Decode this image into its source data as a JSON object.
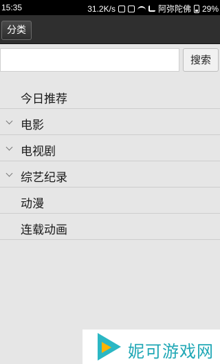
{
  "statusbar": {
    "time": "15:35",
    "net_speed": "31.2K/s",
    "carrier": "阿弥陀佛",
    "battery": "29%",
    "icons": [
      "headset-icon",
      "alarm-icon",
      "wifi-icon",
      "signal-icon",
      "battery-icon"
    ]
  },
  "header": {
    "category_button": "分类"
  },
  "search": {
    "input_value": "",
    "button_label": "搜索"
  },
  "list": {
    "items": [
      {
        "label": "今日推荐",
        "expandable": false
      },
      {
        "label": "电影",
        "expandable": true
      },
      {
        "label": "电视剧",
        "expandable": true
      },
      {
        "label": "综艺纪录",
        "expandable": true
      },
      {
        "label": "动漫",
        "expandable": false
      },
      {
        "label": "连载动画",
        "expandable": false
      }
    ]
  },
  "watermark": {
    "text": "妮可游戏网"
  },
  "colors": {
    "header_bg": "#2f2f2f",
    "page_bg": "#e6e6e6",
    "watermark_teal": "#1fa7b5",
    "watermark_orange": "#ffb400"
  }
}
